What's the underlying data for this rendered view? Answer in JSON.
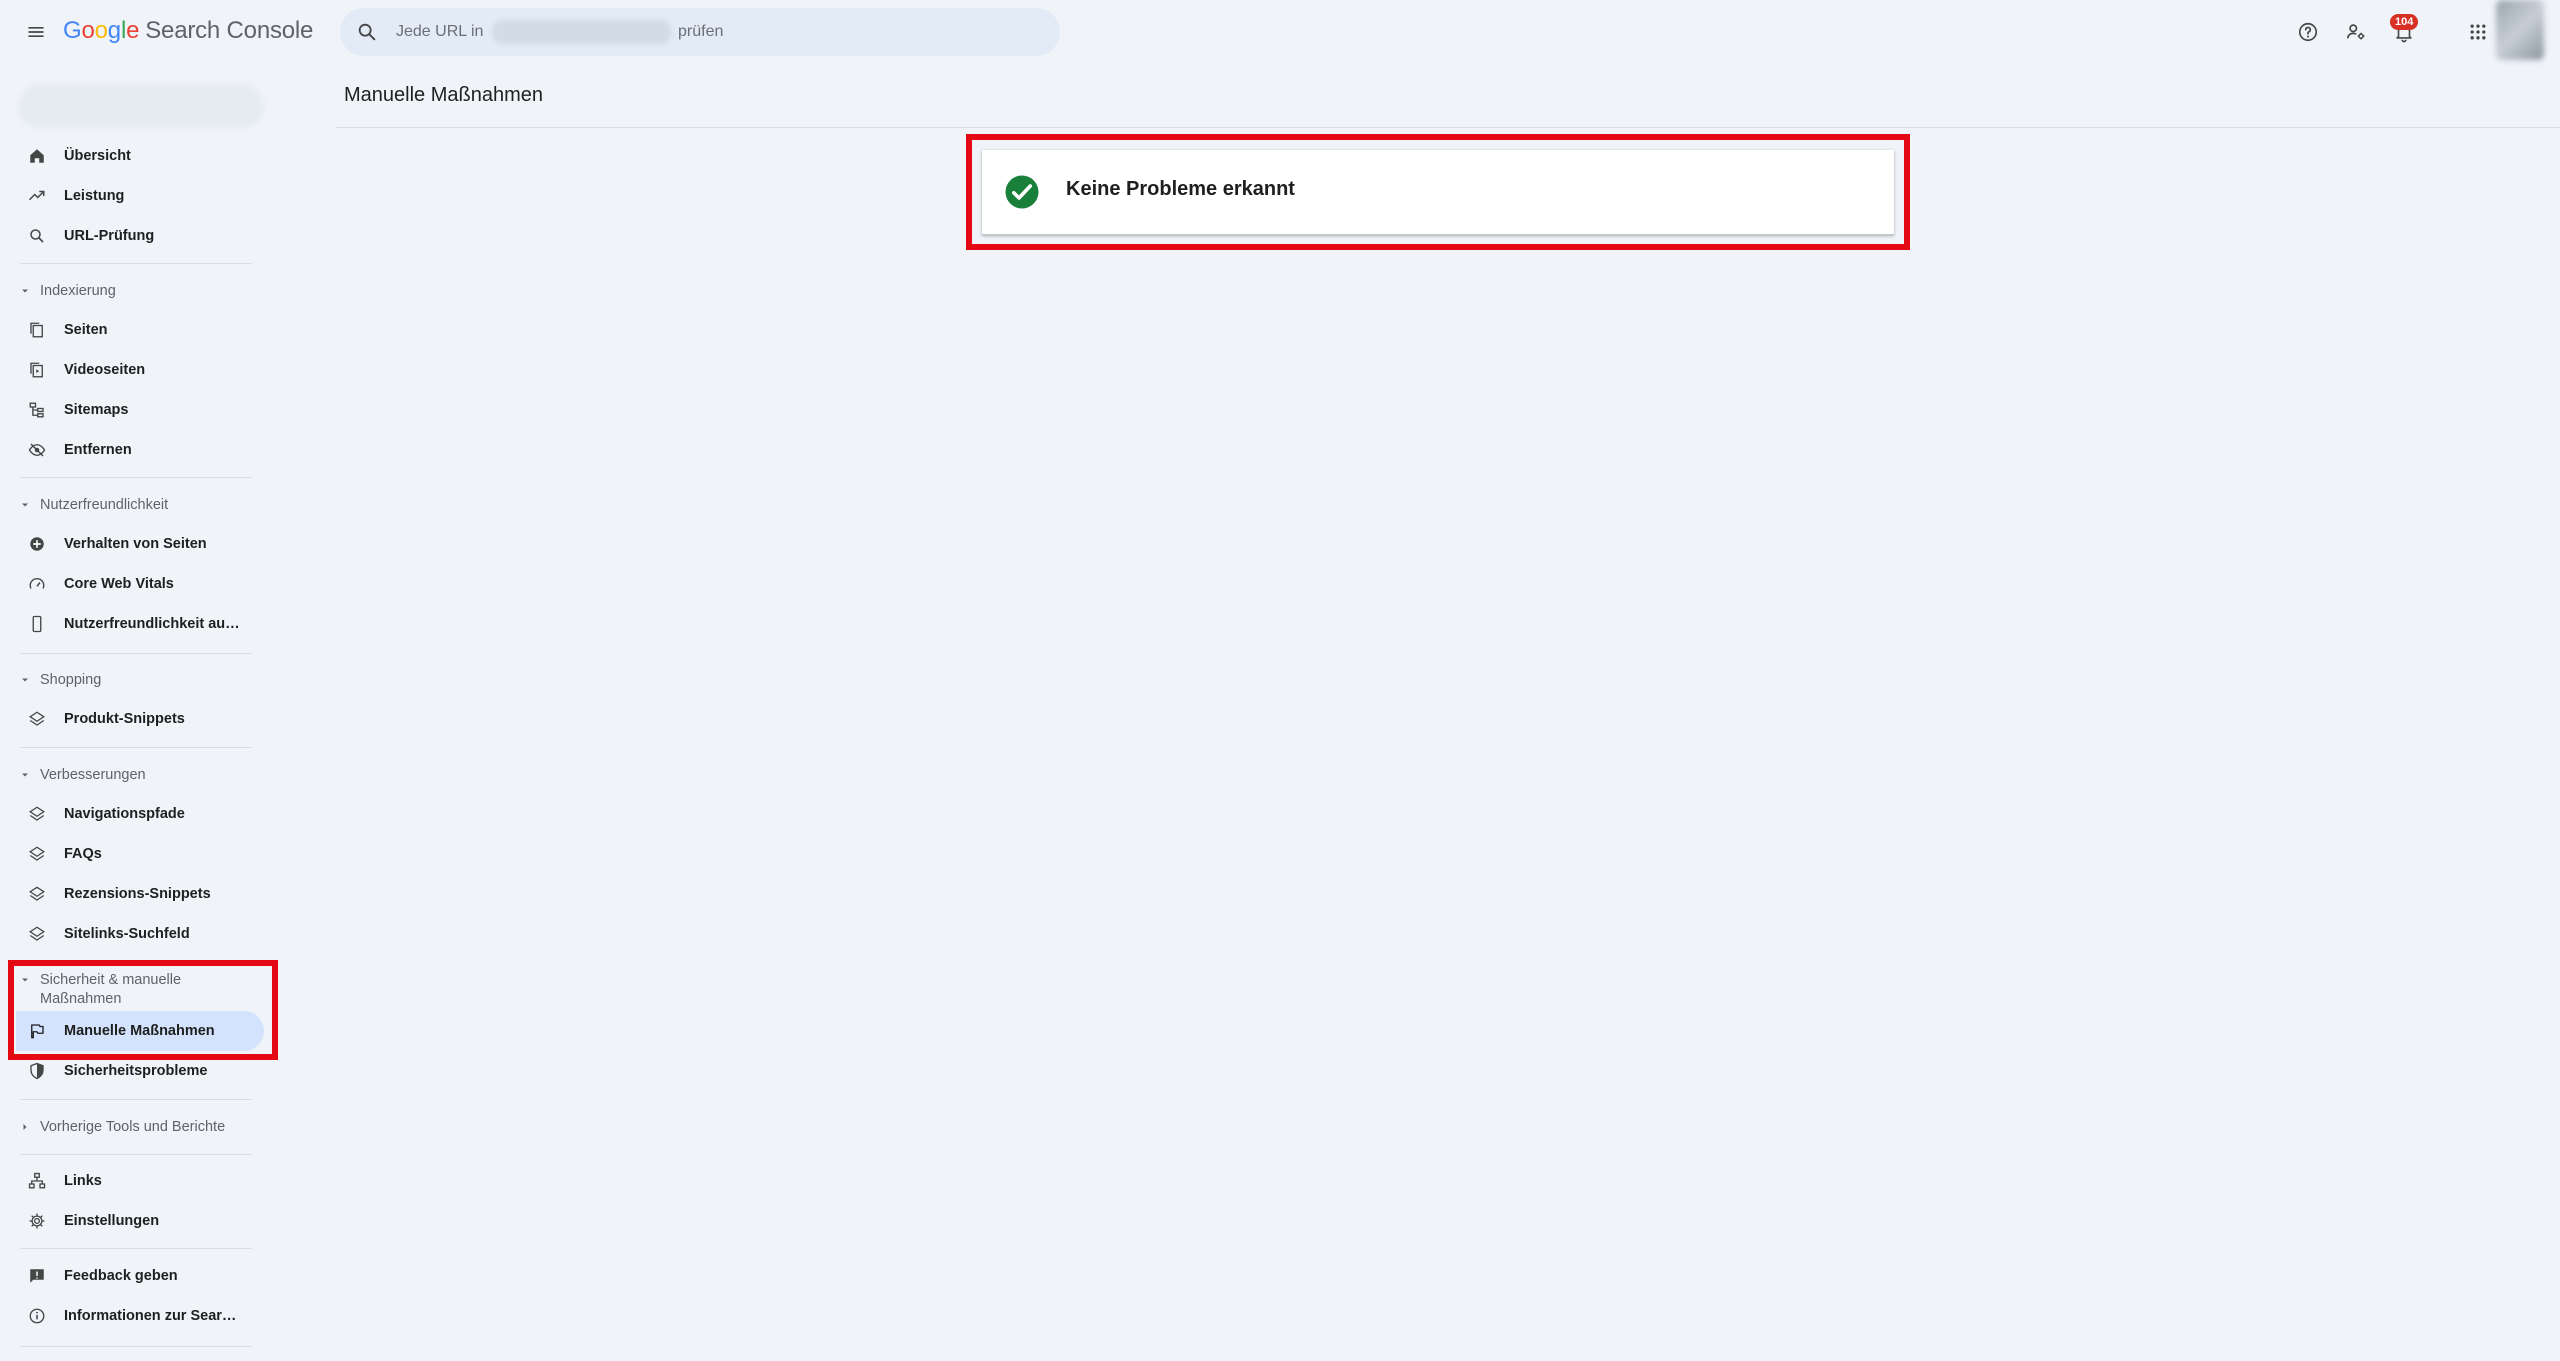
{
  "app": {
    "logo_letters": [
      "G",
      "o",
      "o",
      "g",
      "l",
      "e"
    ],
    "product": "Search Console"
  },
  "search": {
    "prefix": "Jede URL in",
    "suffix": "prüfen"
  },
  "notifications": {
    "count": "104"
  },
  "page": {
    "title": "Manuelle Maßnahmen"
  },
  "status": {
    "text": "Keine Probleme erkannt"
  },
  "sidebar": {
    "top_items": [
      {
        "label": "Übersicht",
        "icon": "home-icon"
      },
      {
        "label": "Leistung",
        "icon": "trending-up-icon"
      },
      {
        "label": "URL-Prüfung",
        "icon": "search-icon"
      }
    ],
    "sections": [
      {
        "title": "Indexierung",
        "items": [
          {
            "label": "Seiten",
            "icon": "pages-icon"
          },
          {
            "label": "Videoseiten",
            "icon": "video-pages-icon"
          },
          {
            "label": "Sitemaps",
            "icon": "sitemap-icon"
          },
          {
            "label": "Entfernen",
            "icon": "eye-off-icon"
          }
        ]
      },
      {
        "title": "Nutzerfreundlichkeit",
        "items": [
          {
            "label": "Verhalten von Seiten",
            "icon": "plus-circle-icon"
          },
          {
            "label": "Core Web Vitals",
            "icon": "speedometer-icon"
          },
          {
            "label": "Nutzerfreundlichkeit au…",
            "icon": "mobile-icon"
          }
        ]
      },
      {
        "title": "Shopping",
        "items": [
          {
            "label": "Produkt-Snippets",
            "icon": "layers-icon"
          }
        ]
      },
      {
        "title": "Verbesserungen",
        "items": [
          {
            "label": "Navigationspfade",
            "icon": "layers-icon"
          },
          {
            "label": "FAQs",
            "icon": "layers-icon"
          },
          {
            "label": "Rezensions-Snippets",
            "icon": "layers-icon"
          },
          {
            "label": "Sitelinks-Suchfeld",
            "icon": "layers-icon"
          }
        ]
      },
      {
        "title_line1": "Sicherheit & manuelle",
        "title_line2": "Maßnahmen",
        "items": [
          {
            "label": "Manuelle Maßnahmen",
            "icon": "flag-icon",
            "active": true
          },
          {
            "label": "Sicherheitsprobleme",
            "icon": "shield-icon"
          }
        ]
      },
      {
        "title": "Vorherige Tools und Berichte",
        "collapsed": true
      }
    ],
    "bottom_items": [
      {
        "label": "Links",
        "icon": "links-icon"
      },
      {
        "label": "Einstellungen",
        "icon": "gear-icon"
      },
      {
        "label": "Feedback geben",
        "icon": "feedback-icon"
      },
      {
        "label": "Informationen zur Sear…",
        "icon": "info-icon"
      }
    ]
  },
  "colors": {
    "accent_active": "#d3e3fd",
    "success_green": "#188038",
    "highlight_red": "#e50914",
    "badge_red": "#d93025"
  }
}
